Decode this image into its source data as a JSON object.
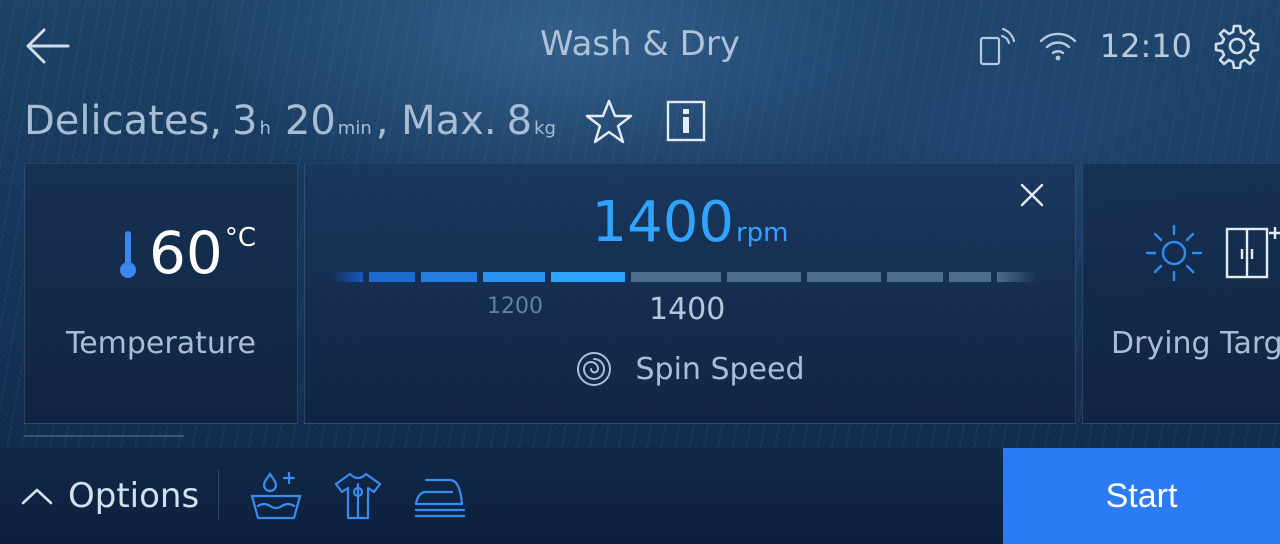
{
  "header": {
    "title": "Wash & Dry",
    "time": "12:10",
    "icons": [
      "back-arrow-icon",
      "remote-start-icon",
      "wifi-icon",
      "gear-icon"
    ]
  },
  "program": {
    "name": "Delicates,",
    "hours": "3",
    "hours_unit": "h",
    "minutes": "20",
    "minutes_unit": "min",
    "max_prefix": ", Max.",
    "max_load": "8",
    "max_unit": "kg",
    "favorite_icon": "star-icon",
    "info_icon": "info-icon"
  },
  "cards": {
    "temperature": {
      "value": "60",
      "unit": "°C",
      "label": "Temperature",
      "icon": "thermometer-icon"
    },
    "spin": {
      "value": "1400",
      "unit": "rpm",
      "label": "Spin Speed",
      "prev_tick": "1200",
      "current_tick": "1400",
      "icon": "spin-icon",
      "close_icon": "close-icon",
      "accent_color": "#2fa4ff",
      "selected_steps": 5,
      "total_steps": 11
    },
    "drying": {
      "label": "Drying Targ",
      "icons": [
        "sun-icon",
        "wardrobe-icon"
      ]
    }
  },
  "bottom": {
    "options_label": "Options",
    "option_icons": [
      "extra-water-icon",
      "anti-wrinkle-icon",
      "easy-iron-icon"
    ],
    "start_label": "Start",
    "start_color": "#2b7cf4"
  }
}
